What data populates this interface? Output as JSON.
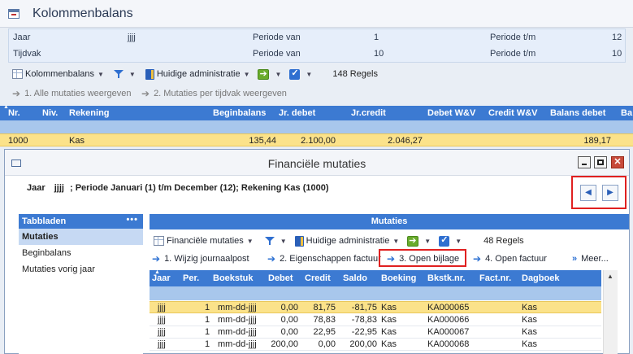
{
  "main": {
    "title": "Kolommenbalans",
    "params": {
      "jaar_label": "Jaar",
      "jaar_value": "jjjj",
      "tijdvak_label": "Tijdvak",
      "periode_van_label": "Periode van",
      "periode_van_1": "1",
      "periode_van_2": "10",
      "periode_tm_label": "Periode t/m",
      "periode_tm_1": "12",
      "periode_tm_2": "10"
    },
    "toolbar": {
      "kolommenbalans": "Kolommenbalans",
      "huidige_administratie": "Huidige administratie",
      "regels": "148 Regels"
    },
    "actions": [
      "1. Alle mutaties weergeven",
      "2. Mutaties per tijdvak weergeven"
    ],
    "grid": {
      "headers": [
        "Nr.",
        "Niv.",
        "Rekening",
        "Beginbalans",
        "Jr. debet",
        "Jr.credit",
        "Debet W&V",
        "Credit W&V",
        "Balans debet",
        "Ba"
      ],
      "row": {
        "nr": "1000",
        "rekening": "Kas",
        "beginbalans": "135,44",
        "jr_debet": "2.100,00",
        "jr_credit": "2.046,27",
        "balans_debet": "189,17"
      }
    }
  },
  "child": {
    "title": "Financiële mutaties",
    "info": {
      "jaar_label": "Jaar",
      "jaar_value": "jjjj",
      "rest": "; Periode Januari (1) t/m December (12); Rekening Kas (1000)"
    },
    "nav": {
      "prev": "◀",
      "next": "▶"
    },
    "tabbladen": {
      "title": "Tabbladen",
      "dots": "•••",
      "items": [
        "Mutaties",
        "Beginbalans",
        "Mutaties vorig jaar"
      ]
    },
    "mutaties": {
      "title": "Mutaties",
      "toolbar": {
        "financiele": "Financiële mutaties",
        "huidige_administratie": "Huidige administratie",
        "regels": "48 Regels"
      },
      "actions": [
        "1. Wijzig journaalpost",
        "2. Eigenschappen factuur",
        "3. Open bijlage",
        "4. Open factuur",
        "Meer..."
      ],
      "headers": [
        "Jaar",
        "Per.",
        "Boekstuk",
        "Debet",
        "Credit",
        "Saldo",
        "Boeking",
        "Bkstk.nr.",
        "Fact.nr.",
        "Dagboek"
      ],
      "rows": [
        {
          "jaar": "jjjj",
          "per": "1",
          "boekstuk": "mm-dd-jjjj",
          "debet": "0,00",
          "credit": "81,75",
          "saldo": "-81,75",
          "boeking": "Kas",
          "bkstk": "KA000065",
          "dagboek": "Kas"
        },
        {
          "jaar": "jjjj",
          "per": "1",
          "boekstuk": "mm-dd-jjjj",
          "debet": "0,00",
          "credit": "78,83",
          "saldo": "-78,83",
          "boeking": "Kas",
          "bkstk": "KA000066",
          "dagboek": "Kas"
        },
        {
          "jaar": "jjjj",
          "per": "1",
          "boekstuk": "mm-dd-jjjj",
          "debet": "0,00",
          "credit": "22,95",
          "saldo": "-22,95",
          "boeking": "Kas",
          "bkstk": "KA000067",
          "dagboek": "Kas"
        },
        {
          "jaar": "jjjj",
          "per": "1",
          "boekstuk": "mm-dd-jjjj",
          "debet": "200,00",
          "credit": "0,00",
          "saldo": "200,00",
          "boeking": "Kas",
          "bkstk": "KA000068",
          "dagboek": "Kas"
        }
      ]
    }
  },
  "colors": {
    "accent": "#3c7ad2",
    "selected_row": "#fbe28a",
    "highlight_box": "#e02020"
  }
}
